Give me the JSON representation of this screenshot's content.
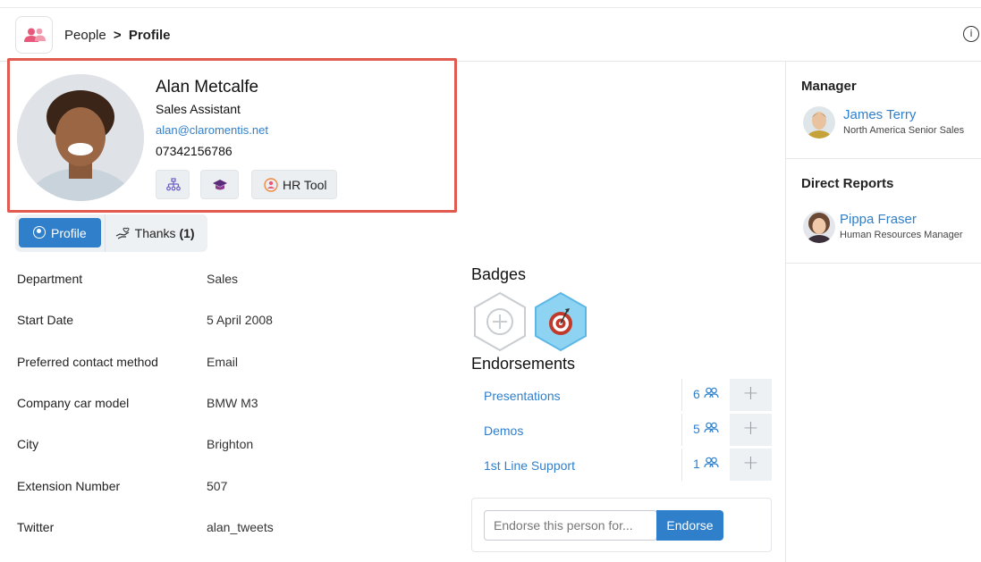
{
  "header": {
    "app_icon": "people-icon",
    "breadcrumb_parent": "People",
    "breadcrumb_separator": ">",
    "breadcrumb_current": "Profile",
    "info_icon": "info-icon"
  },
  "profile": {
    "name": "Alan Metcalfe",
    "job_title": "Sales Assistant",
    "email": "alan@claromentis.net",
    "phone": "07342156786",
    "buttons": {
      "org_chart_icon": "org-chart-icon",
      "learning_icon": "graduation-cap-icon",
      "hr_tool_label": "HR Tool",
      "hr_tool_icon": "hr-tool-icon"
    }
  },
  "tabs": {
    "profile_label": "Profile",
    "thanks_label": "Thanks",
    "thanks_count": "(1)"
  },
  "fields": [
    {
      "label": "Department",
      "value": "Sales"
    },
    {
      "label": "Start Date",
      "value": "5 April 2008"
    },
    {
      "label": "Preferred contact method",
      "value": "Email"
    },
    {
      "label": "Company car model",
      "value": "BMW M3"
    },
    {
      "label": "City",
      "value": "Brighton"
    },
    {
      "label": "Extension Number",
      "value": "507"
    },
    {
      "label": "Twitter",
      "value": "alan_tweets"
    }
  ],
  "badges": {
    "title": "Badges",
    "items": [
      "add-badge-icon",
      "target-badge-icon"
    ]
  },
  "endorsements": {
    "title": "Endorsements",
    "items": [
      {
        "skill": "Presentations",
        "count": "6"
      },
      {
        "skill": "Demos",
        "count": "5"
      },
      {
        "skill": "1st Line Support",
        "count": "1"
      }
    ],
    "input_placeholder": "Endorse this person for...",
    "button_label": "Endorse"
  },
  "sidebar": {
    "manager": {
      "title": "Manager",
      "name": "James Terry",
      "role": "North America Senior Sales"
    },
    "direct_reports": {
      "title": "Direct Reports",
      "items": [
        {
          "name": "Pippa Fraser",
          "role": "Human Resources Manager"
        }
      ]
    }
  },
  "colors": {
    "accent": "#2f7fcb",
    "highlight_border": "#e05a4f",
    "brand_icon": "#e8587a"
  }
}
